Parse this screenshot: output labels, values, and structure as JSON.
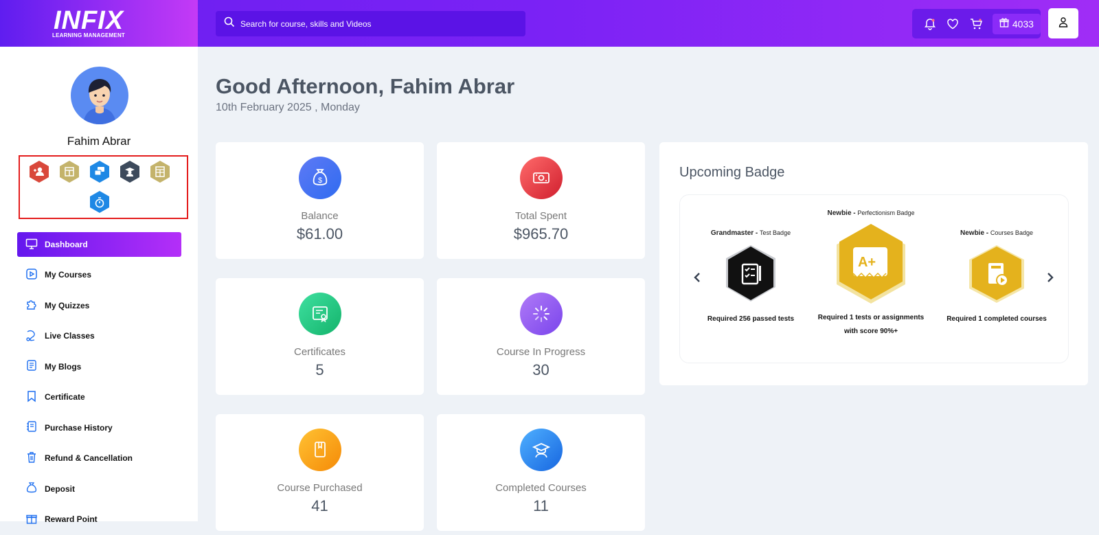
{
  "header": {
    "logo": "INFIX",
    "logo_sub": "LEARNING MANAGEMENT",
    "search_placeholder": "Search for course, skills and Videos",
    "points": "4033"
  },
  "sidebar": {
    "user_name": "Fahim Abrar",
    "badges": [
      {
        "icon": "user-plus-icon",
        "color": "#d9483b"
      },
      {
        "icon": "layout-icon",
        "color": "#c4b36b"
      },
      {
        "icon": "chat-icon",
        "color": "#1e88e5"
      },
      {
        "icon": "graduate-icon",
        "color": "#3d4a5c"
      },
      {
        "icon": "table-icon",
        "color": "#c4b36b"
      },
      {
        "icon": "timer-icon",
        "color": "#1e88e5"
      }
    ],
    "menu": [
      {
        "label": "Dashboard",
        "icon": "monitor-icon"
      },
      {
        "label": "My Courses",
        "icon": "play-square-icon"
      },
      {
        "label": "My Quizzes",
        "icon": "puzzle-icon"
      },
      {
        "label": "Live Classes",
        "icon": "live-icon"
      },
      {
        "label": "My Blogs",
        "icon": "blog-icon"
      },
      {
        "label": "Certificate",
        "icon": "bookmark-icon"
      },
      {
        "label": "Purchase History",
        "icon": "receipt-icon"
      },
      {
        "label": "Refund & Cancellation",
        "icon": "trash-icon"
      },
      {
        "label": "Deposit",
        "icon": "money-bag-icon"
      },
      {
        "label": "Reward Point",
        "icon": "gift-icon"
      }
    ]
  },
  "main": {
    "greeting": "Good Afternoon, Fahim Abrar",
    "date": "10th February 2025 , Monday",
    "cards": [
      {
        "label": "Balance",
        "value": "$61.00",
        "icon": "money-bag-icon",
        "color": "#3a7bf2"
      },
      {
        "label": "Total Spent",
        "value": "$965.70",
        "icon": "cash-icon",
        "color": "#e83a3a"
      },
      {
        "label": "Certificates",
        "value": "5",
        "icon": "certificate-icon",
        "color": "#23c77d"
      },
      {
        "label": "Course In Progress",
        "value": "30",
        "icon": "progress-icon",
        "color": "#8c55ef"
      },
      {
        "label": "Course Purchased",
        "value": "41",
        "icon": "book-icon",
        "color": "#f7a21a"
      },
      {
        "label": "Completed Courses",
        "value": "11",
        "icon": "graduate-icon",
        "color": "#2c8df0"
      }
    ],
    "upcoming": {
      "title": "Upcoming Badge",
      "badges": [
        {
          "level": "Grandmaster",
          "type": "Test Badge",
          "req": "Required 256 passed tests"
        },
        {
          "level": "Newbie",
          "type": "Perfectionism Badge",
          "req1": "Required 1 tests or assignments",
          "req2": "with score 90%+"
        },
        {
          "level": "Newbie",
          "type": "Courses Badge",
          "req": "Required 1 completed courses"
        }
      ]
    }
  }
}
